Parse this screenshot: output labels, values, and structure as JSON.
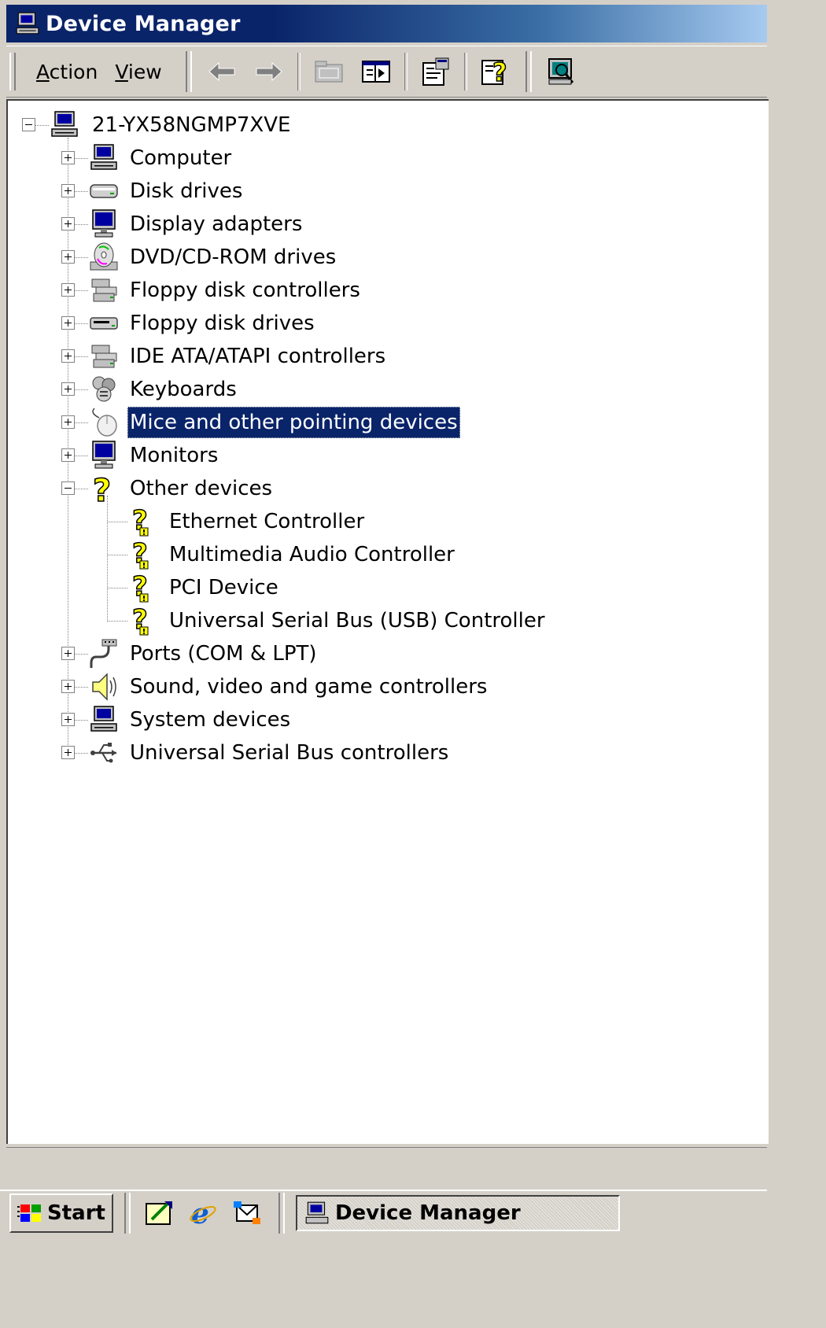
{
  "window": {
    "title": "Device Manager",
    "icon": "computer-icon"
  },
  "toolbar": {
    "menus": [
      {
        "label": "Action",
        "accel": "A",
        "rest": "ction"
      },
      {
        "label": "View",
        "accel": "V",
        "rest": "iew"
      }
    ],
    "buttons": [
      {
        "name": "back-button",
        "icon": "left-arrow-icon",
        "enabled": false
      },
      {
        "name": "forward-button",
        "icon": "right-arrow-icon",
        "enabled": false
      },
      {
        "name": "up-button",
        "icon": "folder-up-icon",
        "enabled": false
      },
      {
        "name": "show-hide-console-tree-button",
        "icon": "console-tree-icon",
        "enabled": true
      },
      {
        "name": "properties-button",
        "icon": "properties-icon",
        "enabled": true
      },
      {
        "name": "help-button",
        "icon": "help-icon",
        "enabled": true
      },
      {
        "name": "scan-hardware-button",
        "icon": "scan-hardware-icon",
        "enabled": true
      }
    ]
  },
  "tree": {
    "root": {
      "label": "21-YX58NGMP7XVE",
      "icon": "computer-icon",
      "expanded": true
    },
    "categories": [
      {
        "label": "Computer",
        "icon": "computer-icon",
        "expanded": false
      },
      {
        "label": "Disk drives",
        "icon": "disk-drive-icon",
        "expanded": false
      },
      {
        "label": "Display adapters",
        "icon": "monitor-icon",
        "expanded": false
      },
      {
        "label": "DVD/CD-ROM drives",
        "icon": "cd-rom-icon",
        "expanded": false
      },
      {
        "label": "Floppy disk controllers",
        "icon": "controller-icon",
        "expanded": false
      },
      {
        "label": "Floppy disk drives",
        "icon": "floppy-drive-icon",
        "expanded": false
      },
      {
        "label": "IDE ATA/ATAPI controllers",
        "icon": "controller-icon",
        "expanded": false
      },
      {
        "label": "Keyboards",
        "icon": "keyboard-icon",
        "expanded": false
      },
      {
        "label": "Mice and other pointing devices",
        "icon": "mouse-icon",
        "expanded": false,
        "selected": true
      },
      {
        "label": "Monitors",
        "icon": "monitor-icon",
        "expanded": false
      },
      {
        "label": "Other devices",
        "icon": "unknown-device-icon",
        "expanded": true,
        "children": [
          {
            "label": "Ethernet Controller",
            "icon": "warning-question-icon"
          },
          {
            "label": "Multimedia Audio Controller",
            "icon": "warning-question-icon"
          },
          {
            "label": "PCI Device",
            "icon": "warning-question-icon"
          },
          {
            "label": "Universal Serial Bus (USB) Controller",
            "icon": "warning-question-icon"
          }
        ]
      },
      {
        "label": "Ports (COM & LPT)",
        "icon": "port-icon",
        "expanded": false
      },
      {
        "label": "Sound, video and game controllers",
        "icon": "speaker-icon",
        "expanded": false
      },
      {
        "label": "System devices",
        "icon": "computer-icon",
        "expanded": false
      },
      {
        "label": "Universal Serial Bus controllers",
        "icon": "usb-icon",
        "expanded": false
      }
    ]
  },
  "statusbar": {
    "text": ""
  },
  "taskbar": {
    "start_label": "Start",
    "quick_launch": [
      "show-desktop-icon",
      "internet-explorer-icon",
      "outlook-express-icon"
    ],
    "task_button_label": "Device Manager"
  },
  "colors": {
    "title_start": "#0a246a",
    "title_end": "#a6caf0",
    "selection": "#0a246a",
    "face": "#d4d0c8",
    "warning_yellow": "#ffff00"
  }
}
